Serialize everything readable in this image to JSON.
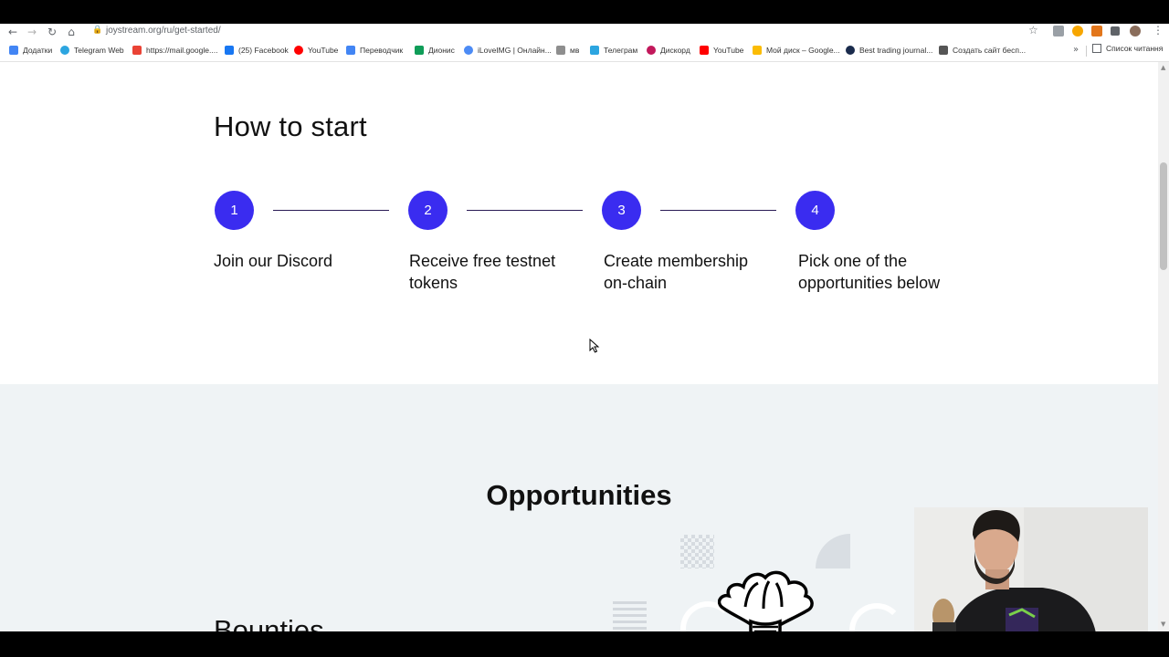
{
  "browser": {
    "url": "joystream.org/ru/get-started/",
    "bookmarks": [
      {
        "label": "Додатки",
        "color": "#4285f4"
      },
      {
        "label": "Telegram Web",
        "color": "#2ca5e0"
      },
      {
        "label": "https://mail.google....",
        "color": "#ea4335"
      },
      {
        "label": "(25) Facebook",
        "color": "#1877f2"
      },
      {
        "label": "YouTube",
        "color": "#ff0000"
      },
      {
        "label": "Переводчик",
        "color": "#4285f4"
      },
      {
        "label": "Дионис",
        "color": "#0f9d58"
      },
      {
        "label": "iLoveIMG | Онлайн...",
        "color": "#4c8bf5"
      },
      {
        "label": "мв",
        "color": "#8e8e8e"
      },
      {
        "label": "Телеграм",
        "color": "#2ca5e0"
      },
      {
        "label": "Дискорд",
        "color": "#c2185b"
      },
      {
        "label": "YouTube",
        "color": "#ff0000"
      },
      {
        "label": "Мой диск – Google...",
        "color": "#fbbc04"
      },
      {
        "label": "Best trading journal...",
        "color": "#1a2b4c"
      },
      {
        "label": "Создать сайт бесп...",
        "color": "#555555"
      }
    ],
    "reading_list": "Список читання",
    "more": "»"
  },
  "page": {
    "how_to_start": {
      "title": "How to start",
      "steps": [
        {
          "number": "1",
          "label": "Join our Discord"
        },
        {
          "number": "2",
          "label": "Receive free testnet tokens"
        },
        {
          "number": "3",
          "label": "Create membership on-chain"
        },
        {
          "number": "4",
          "label": "Pick one of the opportunities below"
        }
      ]
    },
    "opportunities": {
      "title": "Opportunities",
      "first_item": "Bounties"
    }
  },
  "colors": {
    "accent": "#3a2cf0",
    "section_bg": "#eff3f5",
    "connector": "#2a1a55"
  },
  "icons": [
    "back-icon",
    "forward-icon",
    "reload-icon",
    "home-icon",
    "lock-icon",
    "star-icon",
    "extension-icon",
    "menu-icon",
    "reading-list-icon",
    "cursor-icon"
  ]
}
